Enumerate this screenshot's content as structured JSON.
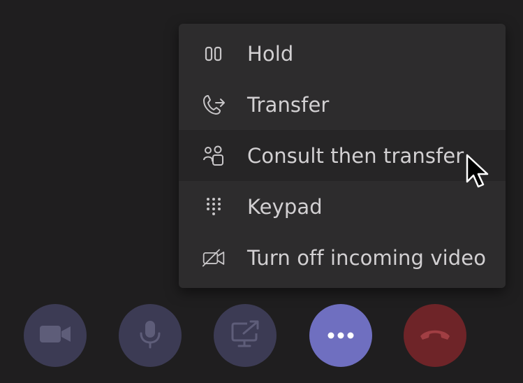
{
  "more_actions_menu": {
    "items": [
      {
        "label": "Hold",
        "icon": "hold-icon"
      },
      {
        "label": "Transfer",
        "icon": "transfer-icon"
      },
      {
        "label": "Consult then transfer",
        "icon": "consult-icon",
        "hovered": true
      },
      {
        "label": "Keypad",
        "icon": "keypad-icon"
      },
      {
        "label": "Turn off incoming video",
        "icon": "video-off-icon"
      }
    ]
  },
  "call_controls": {
    "buttons": [
      {
        "name": "camera",
        "icon": "camera-icon"
      },
      {
        "name": "microphone",
        "icon": "microphone-icon"
      },
      {
        "name": "share-screen",
        "icon": "share-screen-icon"
      },
      {
        "name": "more-actions",
        "icon": "more-icon",
        "active": true
      },
      {
        "name": "hang-up",
        "icon": "hang-up-icon"
      }
    ]
  },
  "colors": {
    "background": "#1f1e1f",
    "menu_background": "#2d2c2d",
    "menu_hover": "#262526",
    "menu_text": "#d2d0d2",
    "control_button": "#3c3b54",
    "control_icon": "#5e5d79",
    "more_button_active": "#6f6fc0",
    "hang_up_button": "#6e2428",
    "hang_up_icon": "#a13e43"
  }
}
